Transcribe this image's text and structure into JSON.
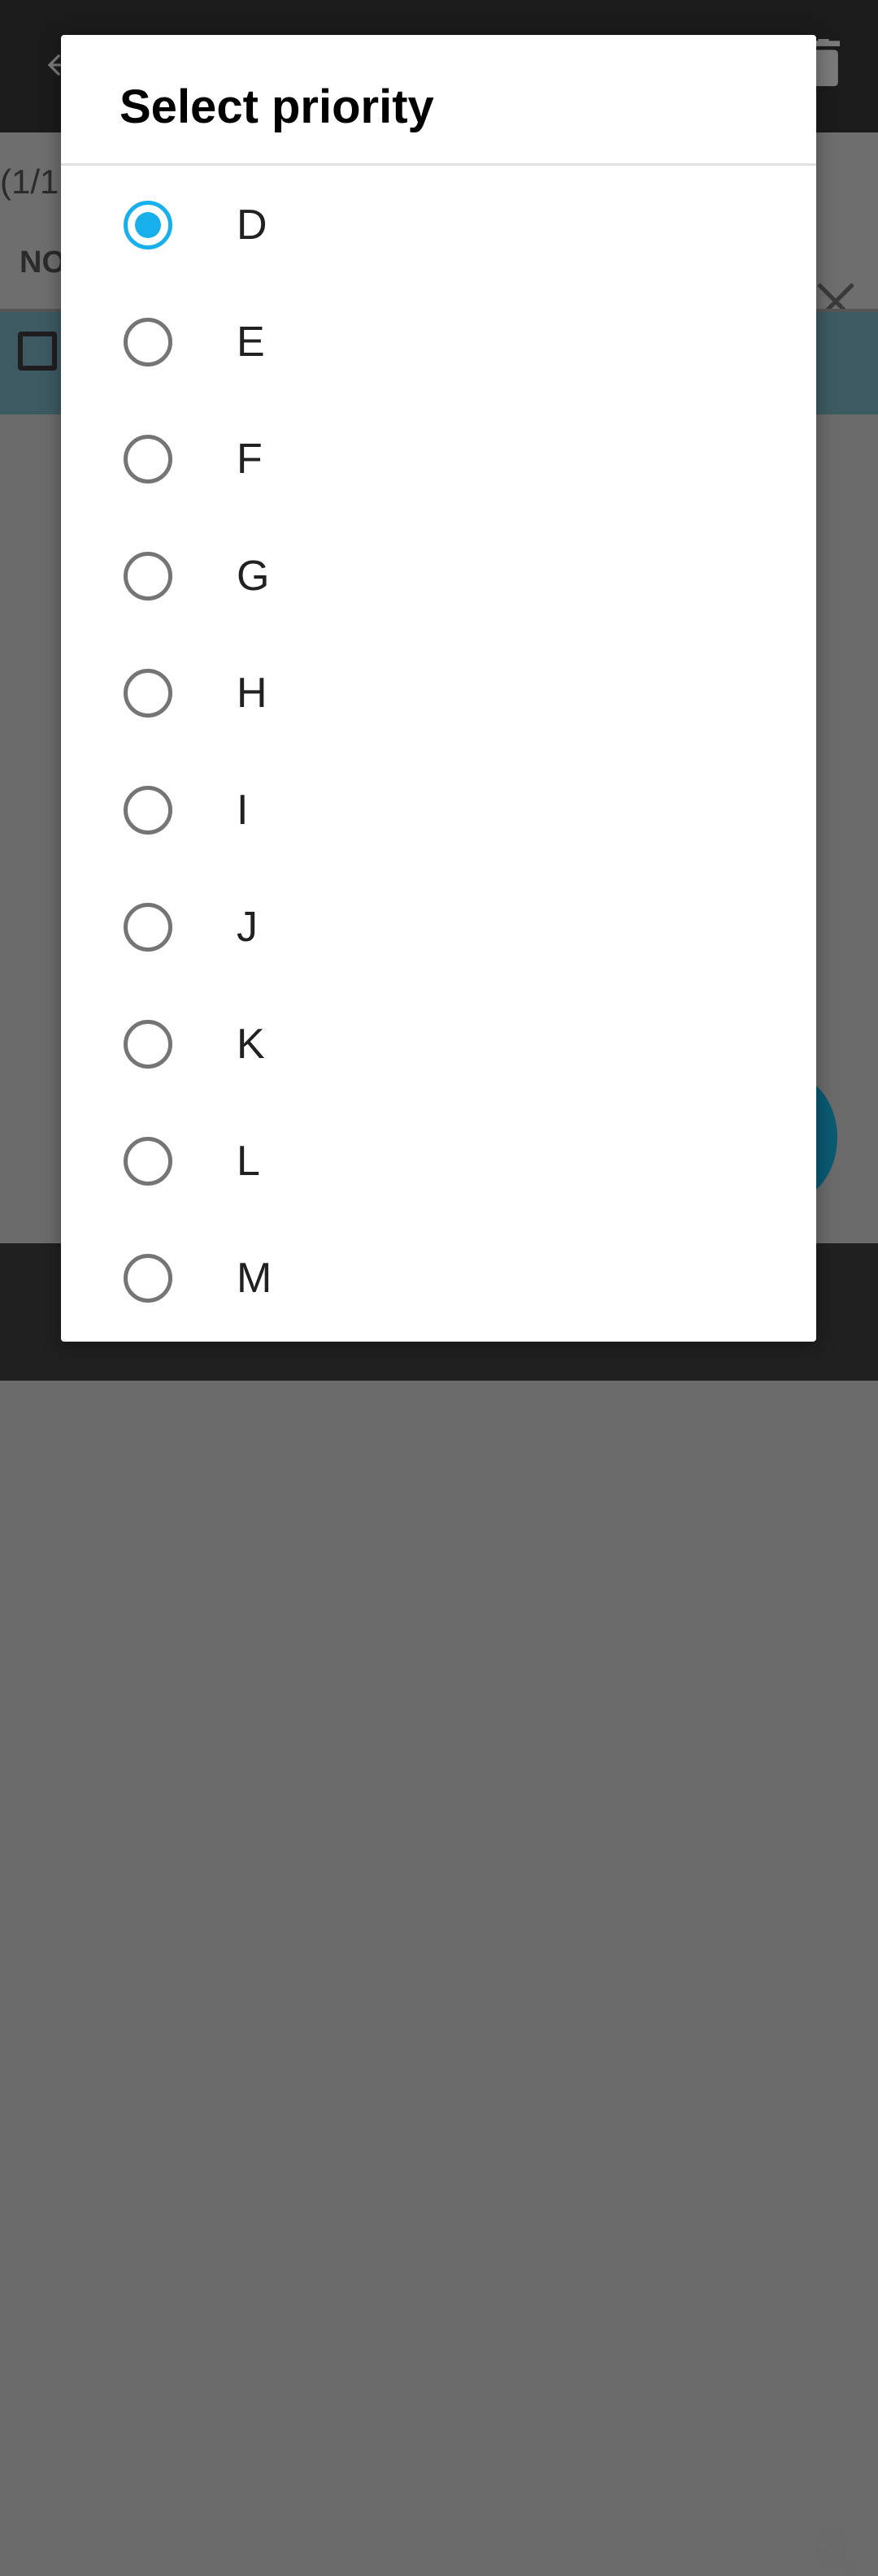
{
  "background": {
    "count_text": "(1/1",
    "sort_label": "NO",
    "icons": [
      "back-arrow-icon",
      "trash-icon",
      "close-icon",
      "history-icon"
    ]
  },
  "dialog": {
    "title": "Select priority",
    "selected_index": 0,
    "options": [
      {
        "label": "D",
        "checked": true
      },
      {
        "label": "E",
        "checked": false
      },
      {
        "label": "F",
        "checked": false
      },
      {
        "label": "G",
        "checked": false
      },
      {
        "label": "H",
        "checked": false
      },
      {
        "label": "I",
        "checked": false
      },
      {
        "label": "J",
        "checked": false
      },
      {
        "label": "K",
        "checked": false
      },
      {
        "label": "L",
        "checked": false
      },
      {
        "label": "M",
        "checked": false
      }
    ]
  },
  "colors": {
    "accent": "#18b0ec",
    "radio_unchecked": "#757575",
    "scrim": "#6b6b6b",
    "toolbar": "#1b1b1b",
    "task_row": "#3d5a62"
  }
}
